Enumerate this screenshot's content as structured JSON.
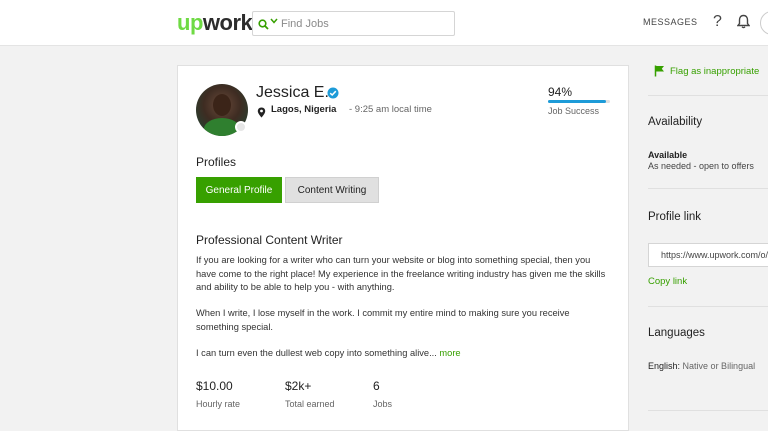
{
  "header": {
    "logo_up": "up",
    "logo_work": "work",
    "search_placeholder": "Find Jobs",
    "messages_label": "MESSAGES",
    "help_label": "?"
  },
  "profile": {
    "name": "Jessica E.",
    "location": "Lagos, Nigeria",
    "local_time": "- 9:25 am local time",
    "job_success_pct": "94%",
    "job_success_value": 94,
    "job_success_label": "Job Success",
    "profiles_heading": "Profiles",
    "tabs": [
      {
        "label": "General Profile",
        "active": true
      },
      {
        "label": "Content Writing",
        "active": false
      }
    ],
    "title": "Professional Content Writer",
    "description_1": "If you are looking for a writer who can turn your website or blog into something special, then you have come to the right place! My experience in the freelance writing industry has given me the skills and ability to be able to help you - with anything.",
    "description_2": "When I write, I lose myself in the work. I commit my entire mind to making sure you receive something special.",
    "description_3": "I can turn even the dullest web copy into something alive...",
    "more_label": "more",
    "stats": [
      {
        "value": "$10.00",
        "label": "Hourly rate"
      },
      {
        "value": "$2k+",
        "label": "Total earned"
      },
      {
        "value": "6",
        "label": "Jobs"
      }
    ]
  },
  "sidebar": {
    "flag_label": "Flag as inappropriate",
    "availability_heading": "Availability",
    "availability_status": "Available",
    "availability_detail": "As needed - open to offers",
    "profile_link_heading": "Profile link",
    "profile_link_value": "https://www.upwork.com/o/profiles/users/",
    "copy_link_label": "Copy link",
    "languages_heading": "Languages",
    "language_name": "English:",
    "language_level": "Native or Bilingual"
  },
  "colors": {
    "brand_green": "#37a000",
    "logo_green": "#6fda44",
    "job_success_blue": "#1d9bd8",
    "verified_blue": "#1d9bd8"
  }
}
